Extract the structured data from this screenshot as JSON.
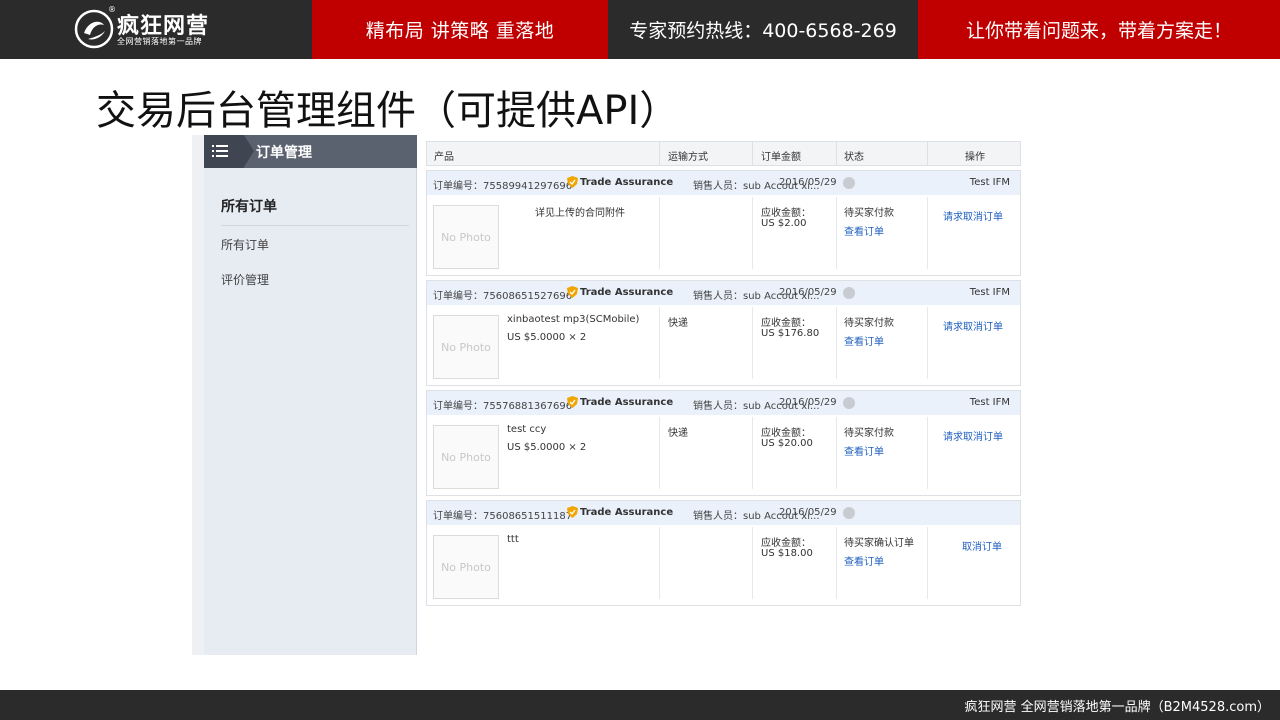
{
  "header": {
    "logo_name": "疯狂网营",
    "logo_slogan": "全网营销落地第一品牌",
    "logo_reg": "®",
    "tagline": "精布局   讲策略   重落地",
    "hotline": "专家预约热线：400-6568-269",
    "slogan": "让你带着问题来，带着方案走！"
  },
  "slide_title": "交易后台管理组件（可提供API）",
  "sidebar": {
    "title": "订单管理",
    "section": "所有订单",
    "items": [
      {
        "label": "所有订单"
      },
      {
        "label": "评价管理"
      }
    ]
  },
  "table": {
    "columns": [
      "产品",
      "运输方式",
      "订单金额",
      "状态",
      "操作"
    ],
    "trade_assurance": "Trade Assurance",
    "photo_placeholder": "No Photo",
    "view_order": "查看订单",
    "orders": [
      {
        "number": "订单编号：75589941297696",
        "seller": "销售人员：sub Accout xi...",
        "date": "2016/05/29",
        "buyer": "Test IFM",
        "product": "详见上传的合同附件",
        "price": "",
        "shipping": "",
        "amount_label": "应收金额：",
        "amount": "US $2.00",
        "status": "待买家付款",
        "action": "请求取消订单"
      },
      {
        "number": "订单编号：75608651527696",
        "seller": "销售人员：sub Accout xi...",
        "date": "2016/05/29",
        "buyer": "Test IFM",
        "product": "xinbaotest mp3(SCMobile)",
        "price": "US $5.0000 × 2",
        "shipping": "快递",
        "amount_label": "应收金额：",
        "amount": "US $176.80",
        "status": "待买家付款",
        "action": "请求取消订单"
      },
      {
        "number": "订单编号：75576881367696",
        "seller": "销售人员：sub Accout xi...",
        "date": "2016/05/29",
        "buyer": "Test IFM",
        "product": "test ccy",
        "price": "US $5.0000 × 2",
        "shipping": "快递",
        "amount_label": "应收金额：",
        "amount": "US $20.00",
        "status": "待买家付款",
        "action": "请求取消订单"
      },
      {
        "number": "订单编号：75608651511187",
        "seller": "销售人员：sub Accout xi...",
        "date": "2016/05/29",
        "buyer": "",
        "product": "ttt",
        "price": "",
        "shipping": "",
        "amount_label": "应收金额：",
        "amount": "US $18.00",
        "status": "待买家确认订单",
        "action": "取消订单"
      }
    ]
  },
  "footer": {
    "text": "疯狂网营  全网营销落地第一品牌（B2M4528.com）"
  },
  "colors": {
    "brand_red": "#c00000",
    "dark": "#2b2b2b",
    "link_blue": "#1f5fbf"
  }
}
